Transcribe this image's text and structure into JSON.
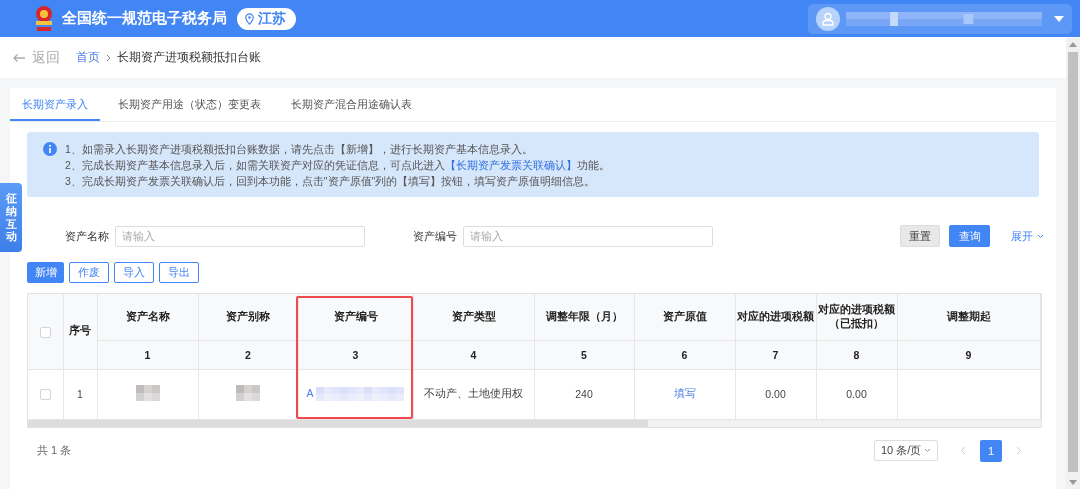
{
  "header": {
    "title": "全国统一规范电子税务局",
    "region": "江苏"
  },
  "breadcrumb": {
    "back": "返回",
    "home": "首页",
    "current": "长期资产进项税额抵扣台账"
  },
  "tabs": [
    {
      "label": "长期资产录入",
      "selected": true
    },
    {
      "label": "长期资产用途（状态）变更表",
      "selected": false
    },
    {
      "label": "长期资产混合用途确认表",
      "selected": false
    }
  ],
  "notice": {
    "lines": [
      {
        "before": "1、如需录入长期资产进项税额抵扣台账数据，请先点击【新增】，进行长期资产基本信息录入。"
      },
      {
        "before": "2、完成长期资产基本信息录入后，如需关联资产对应的凭证信息，可点此进入",
        "link": "【长期资产发票关联确认】",
        "after": "功能。"
      },
      {
        "before": "3、完成长期资产发票关联确认后，回到本功能，点击\"资产原值\"列的【填写】按钮，填写资产原值明细信息。"
      }
    ]
  },
  "side_tab": "征纳互动",
  "filters": [
    {
      "label": "资产名称",
      "placeholder": "请输入"
    },
    {
      "label": "资产编号",
      "placeholder": "请输入"
    }
  ],
  "filter_buttons": {
    "reset": "重置",
    "query": "查询",
    "expand": "展开"
  },
  "actions": [
    {
      "label": "新增",
      "kind": "primary"
    },
    {
      "label": "作废",
      "kind": "default"
    },
    {
      "label": "导入",
      "kind": "default"
    },
    {
      "label": "导出",
      "kind": "default"
    }
  ],
  "table": {
    "select_all_checked": false,
    "columns": [
      {
        "title": "序号"
      },
      {
        "title": "资产名称",
        "number": "1"
      },
      {
        "title": "资产别称",
        "number": "2"
      },
      {
        "title": "资产编号",
        "number": "3",
        "highlighted": true
      },
      {
        "title": "资产类型",
        "number": "4"
      },
      {
        "title": "调整年限（月）",
        "number": "5"
      },
      {
        "title": "资产原值",
        "number": "6"
      },
      {
        "title": "对应的进项税额",
        "number": "7"
      },
      {
        "title": "对应的进项税额（已抵扣）",
        "number": "8"
      },
      {
        "title": "调整期起",
        "number": "9"
      }
    ],
    "rows": [
      {
        "checked": false,
        "cells": [
          {
            "kind": "text",
            "text": "1"
          },
          {
            "kind": "redacted"
          },
          {
            "kind": "redacted"
          },
          {
            "kind": "redacted_link",
            "text": "A"
          },
          {
            "kind": "text",
            "text": "不动产、土地使用权"
          },
          {
            "kind": "text",
            "text": "240"
          },
          {
            "kind": "link",
            "text": "填写"
          },
          {
            "kind": "text",
            "text": "0.00"
          },
          {
            "kind": "text",
            "text": "0.00"
          },
          {
            "kind": "empty"
          }
        ]
      }
    ]
  },
  "footer": {
    "total": "共 1 条",
    "page_size": "10 条/页",
    "pages": [
      {
        "label": "1",
        "selected": true
      }
    ]
  }
}
